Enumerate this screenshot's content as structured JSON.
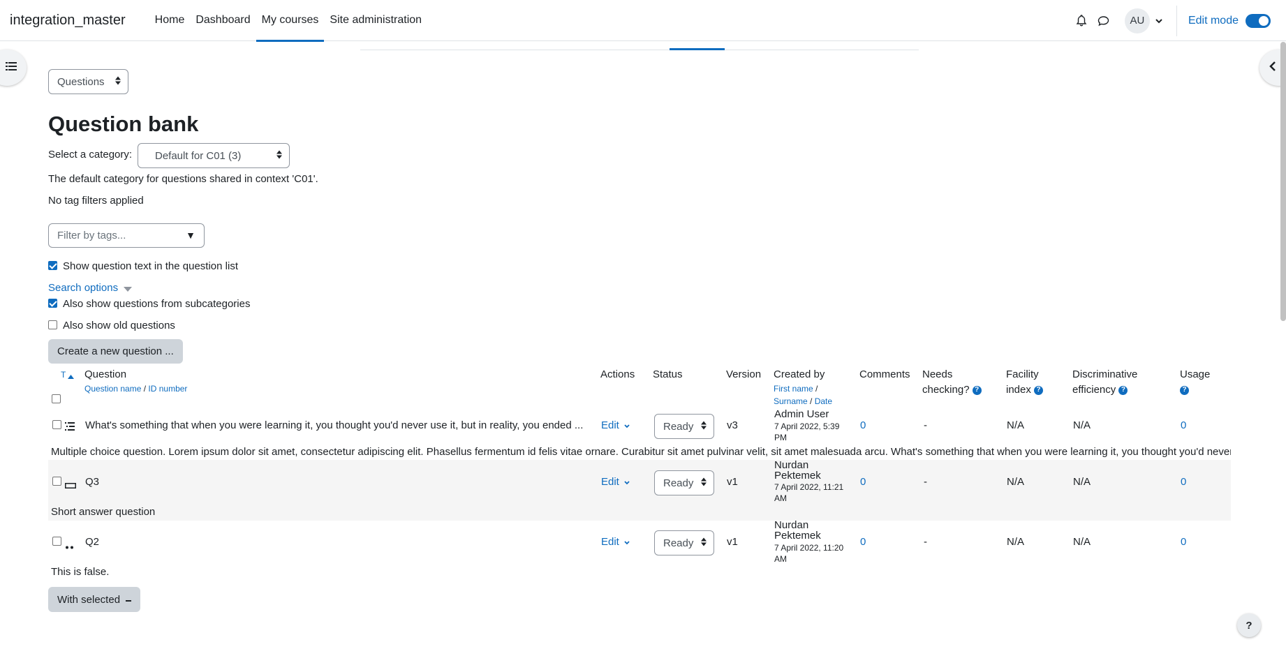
{
  "navbar": {
    "brand": "integration_master",
    "links": [
      "Home",
      "Dashboard",
      "My courses",
      "Site administration"
    ],
    "active": "My courses",
    "user_initials": "AU",
    "edit_mode_label": "Edit mode",
    "edit_mode_on": true
  },
  "page": {
    "view_select": "Questions",
    "title": "Question bank",
    "category_label": "Select a category:",
    "category_value": "Default for C01 (3)",
    "category_desc": "The default category for questions shared in context 'C01'.",
    "tag_filter_status": "No tag filters applied",
    "tag_filter_placeholder": "Filter by tags...",
    "tag_filter_caret": "▼",
    "show_text_label": "Show question text in the question list",
    "search_options": "Search options",
    "subcategories_label": "Also show questions from subcategories",
    "old_questions_label": "Also show old questions",
    "create_button": "Create a new question ...",
    "with_selected": "With selected"
  },
  "table": {
    "headers": {
      "type": "T",
      "question": "Question",
      "question_sub_name": "Question name",
      "question_sub_sep": " / ",
      "question_sub_id": "ID number",
      "actions": "Actions",
      "status": "Status",
      "version": "Version",
      "created_by": "Created by",
      "created_sub_first": "First name",
      "created_sub_surname": "Surname",
      "created_sub_date": "Date",
      "comments": "Comments",
      "needs_checking_1": "Needs",
      "needs_checking_2": "checking?",
      "facility_1": "Facility",
      "facility_2": "index",
      "discrim_1": "Discriminative",
      "discrim_2": "efficiency",
      "usage": "Usage"
    },
    "rows": [
      {
        "name": "What's something that when you were learning it, you thought you'd never use it, but in reality, you ended ...",
        "action": "Edit",
        "status": "Ready",
        "version": "v3",
        "creator": "Admin User",
        "date": "7 April 2022, 5:39",
        "date2": "PM",
        "comments": "0",
        "needs_checking": "-",
        "facility": "N/A",
        "discrim": "N/A",
        "usage": "0",
        "text": "Multiple choice question. Lorem ipsum dolor sit amet, consectetur adipiscing elit. Phasellus fermentum id felis vitae ornare. Curabitur sit amet pulvinar velit, sit amet malesuada arcu. What's something that when you were learning it, you thought you'd never use it"
      },
      {
        "name": "Q3",
        "action": "Edit",
        "status": "Ready",
        "version": "v1",
        "creator": "Nurdan",
        "creator2": "Pektemek",
        "date": "7 April 2022, 11:21",
        "date2": "AM",
        "comments": "0",
        "needs_checking": "-",
        "facility": "N/A",
        "discrim": "N/A",
        "usage": "0",
        "text": "Short answer question"
      },
      {
        "name": "Q2",
        "action": "Edit",
        "status": "Ready",
        "version": "v1",
        "creator": "Nurdan",
        "creator2": "Pektemek",
        "date": "7 April 2022, 11:20",
        "date2": "AM",
        "comments": "0",
        "needs_checking": "-",
        "facility": "N/A",
        "discrim": "N/A",
        "usage": "0",
        "text": "This is false."
      }
    ]
  },
  "help_fab": "?",
  "colors": {
    "accent": "#0f6cbf",
    "text": "#1d2125",
    "button_grey": "#ced4da"
  }
}
